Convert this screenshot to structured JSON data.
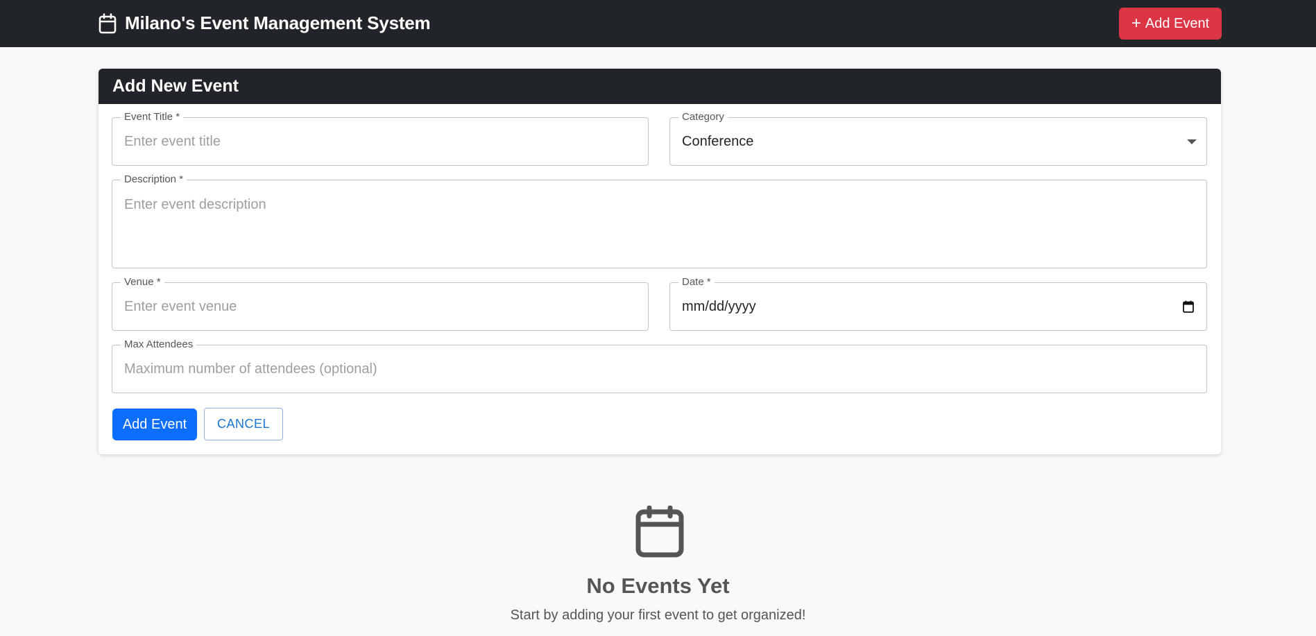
{
  "navbar": {
    "brand_icon": "calendar-icon",
    "brand_title": "Milano's Event Management System",
    "add_button_label": "Add Event",
    "add_button_icon": "plus-icon",
    "add_button_color": "#dc3545"
  },
  "form": {
    "header": "Add New Event",
    "event_title": {
      "label": "Event Title *",
      "placeholder": "Enter event title",
      "value": ""
    },
    "category": {
      "label": "Category",
      "value": "Conference"
    },
    "description": {
      "label": "Description *",
      "placeholder": "Enter event description",
      "value": ""
    },
    "venue": {
      "label": "Venue *",
      "placeholder": "Enter event venue",
      "value": ""
    },
    "date": {
      "label": "Date *",
      "value": "mm/dd/yyyy",
      "icon": "calendar-icon"
    },
    "max_attendees": {
      "label": "Max Attendees",
      "placeholder": "Maximum number of attendees (optional)",
      "value": ""
    },
    "submit_label": "Add Event",
    "submit_color": "#0d6efd",
    "cancel_label": "CANCEL"
  },
  "empty_state": {
    "icon": "calendar-icon",
    "title": "No Events Yet",
    "message": "Start by adding your first event to get organized!"
  }
}
